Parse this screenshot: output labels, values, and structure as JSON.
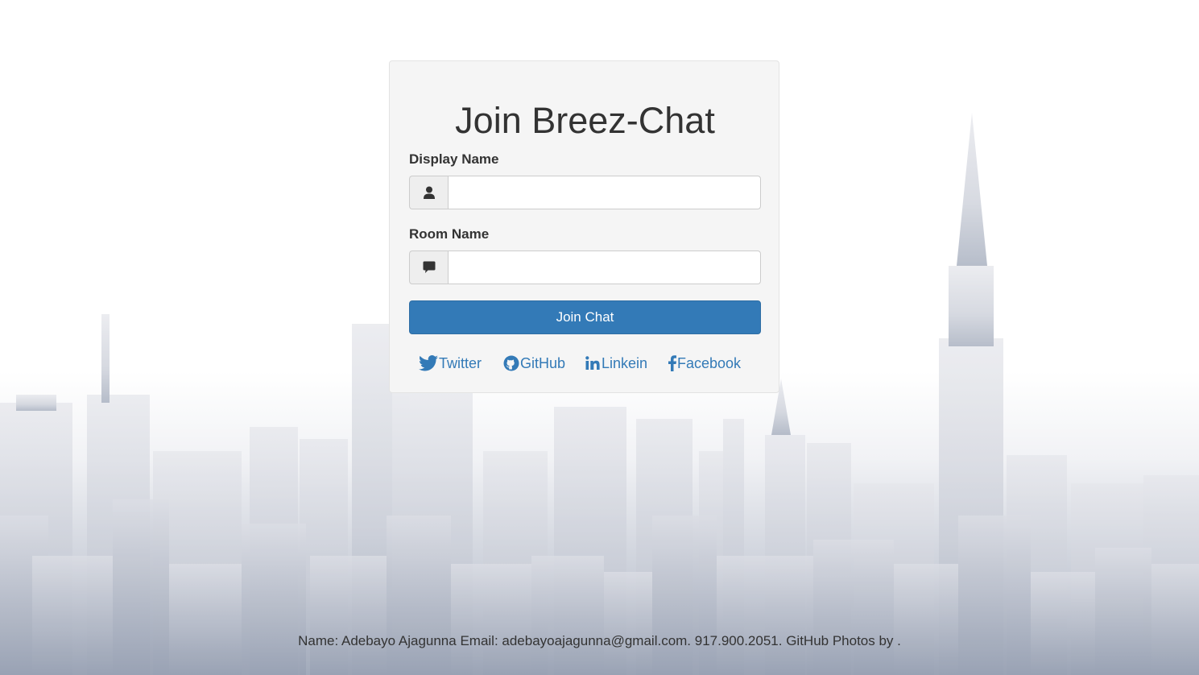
{
  "form": {
    "title": "Join Breez-Chat",
    "display_name_label": "Display Name",
    "display_name_value": "",
    "room_name_label": "Room Name",
    "room_name_value": "",
    "submit_label": "Join Chat",
    "icons": {
      "display_name": "user-icon",
      "room_name": "comment-icon"
    }
  },
  "social_links": [
    {
      "label": "Twitter",
      "icon": "twitter-icon"
    },
    {
      "label": "GitHub",
      "icon": "github-icon"
    },
    {
      "label": "Linkein",
      "icon": "linkedin-icon"
    },
    {
      "label": "Facebook",
      "icon": "facebook-icon"
    }
  ],
  "footer": {
    "text": "Name: Adebayo Ajagunna Email: adebayoajagunna@gmail.com. 917.900.2051. GitHub Photos by ."
  },
  "colors": {
    "primary": "#337ab7",
    "topbar": "#222222",
    "panel": "#f5f5f5",
    "skyline": "#b9bfcc"
  }
}
